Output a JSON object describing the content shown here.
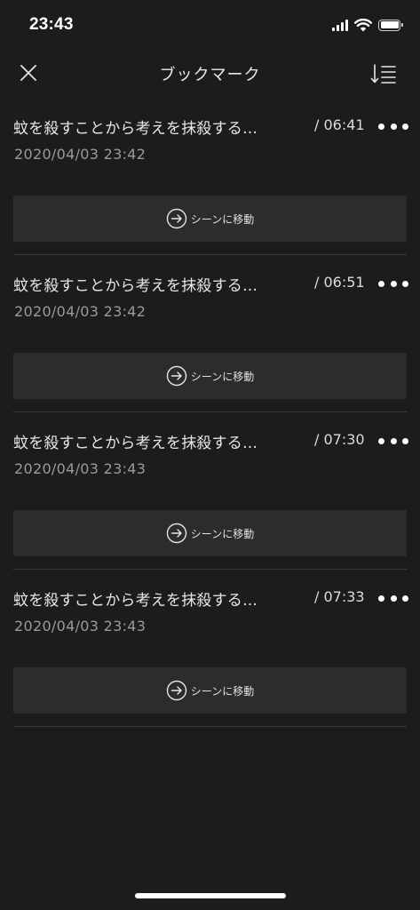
{
  "status_bar": {
    "time": "23:43"
  },
  "nav": {
    "title": "ブックマーク",
    "close_icon": "close-icon",
    "sort_icon": "sort-icon"
  },
  "bookmarks": [
    {
      "title": "蚊を殺すことから考えを抹殺する…",
      "timestamp": "/ 06:41",
      "date": "2020/04/03 23:42",
      "action_label": "シーンに移動"
    },
    {
      "title": "蚊を殺すことから考えを抹殺する…",
      "timestamp": "/ 06:51",
      "date": "2020/04/03 23:42",
      "action_label": "シーンに移動"
    },
    {
      "title": "蚊を殺すことから考えを抹殺する…",
      "timestamp": "/ 07:30",
      "date": "2020/04/03 23:43",
      "action_label": "シーンに移動"
    },
    {
      "title": "蚊を殺すことから考えを抹殺する…",
      "timestamp": "/ 07:33",
      "date": "2020/04/03 23:43",
      "action_label": "シーンに移動"
    }
  ],
  "colors": {
    "background": "#1c1c1e",
    "button": "#2c2c2e",
    "divider": "#3a3a3c",
    "secondary_text": "#9a9a9a"
  }
}
